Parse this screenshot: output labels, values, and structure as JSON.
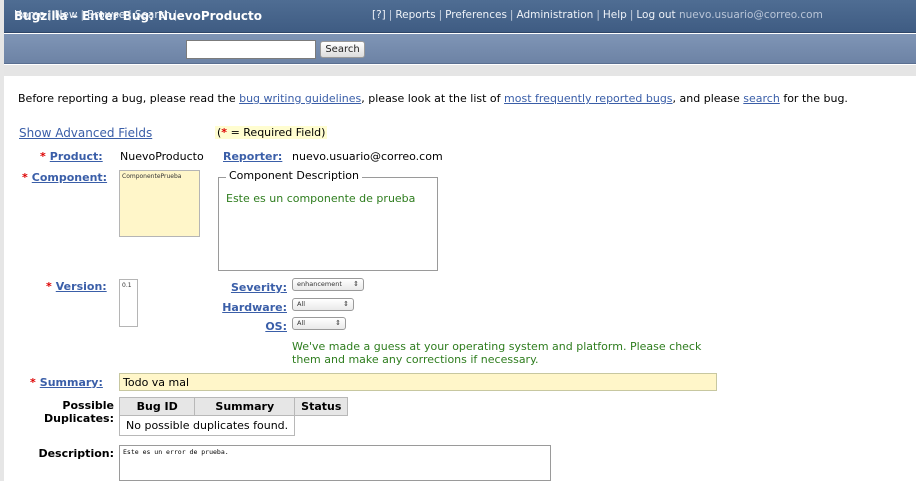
{
  "title": "Bugzilla – Enter Bug: NuevoProducto",
  "nav": {
    "home": "Home",
    "new": "New",
    "browse": "Browse",
    "search": "Search",
    "search_button": "Search",
    "help_q": "[?]",
    "reports": "Reports",
    "preferences": "Preferences",
    "administration": "Administration",
    "help": "Help",
    "logout": "Log out",
    "user": "nuevo.usuario@correo.com"
  },
  "intro": {
    "p1": "Before reporting a bug, please read the ",
    "link1": "bug writing guidelines",
    "p2": ", please look at the list of ",
    "link2": "most frequently reported bugs",
    "p3": ", and please ",
    "link3": "search",
    "p4": " for the bug."
  },
  "advanced": "Show Advanced Fields",
  "required_note": "= Required Field)",
  "required_open": "(",
  "star": "*",
  "fields": {
    "product_label": "Product:",
    "product_value": "NuevoProducto",
    "reporter_label": "Reporter:",
    "reporter_value": "nuevo.usuario@correo.com",
    "component_label": "Component:",
    "component_option": "ComponentePrueba",
    "component_description_legend": "Component Description",
    "component_description": "Este es un componente de prueba",
    "version_label": "Version:",
    "version_option": "0.1",
    "severity_label": "Severity:",
    "severity_value": "enhancement",
    "hardware_label": "Hardware:",
    "hardware_value": "All",
    "os_label": "OS:",
    "os_value": "All",
    "guess_note": "We've made a guess at your operating system and platform. Please check them and make any corrections if necessary.",
    "summary_label": "Summary:",
    "summary_value": "Todo va mal",
    "duplicates_label": "Possible Duplicates:",
    "dup_headers": [
      "Bug ID",
      "Summary",
      "Status"
    ],
    "dup_empty": "No possible duplicates found.",
    "description_label": "Description:",
    "description_value": "Este es un error de prueba."
  },
  "colors": {
    "header_bg": "#4a688f",
    "nav_bg": "#768ead",
    "link": "#3a5ea8",
    "required_star": "#dd0000",
    "note_green": "#2e7d1e",
    "field_highlight": "#fff6c9"
  }
}
